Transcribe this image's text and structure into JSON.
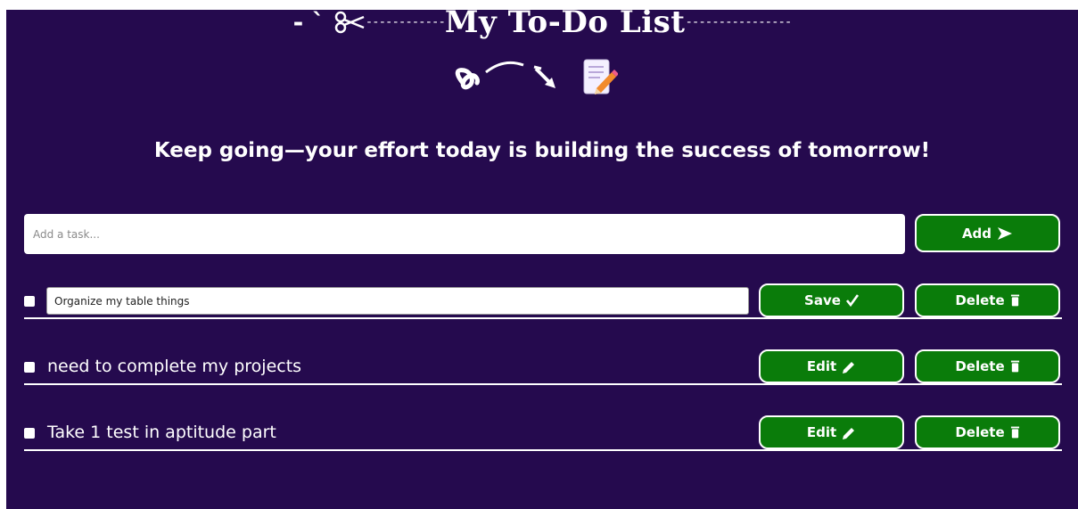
{
  "header": {
    "title": "My To-Do List",
    "motto": "Keep going—your effort today is building the success of tomorrow!"
  },
  "new_task": {
    "placeholder": "Add a task...",
    "add_label": "Add"
  },
  "tasks": [
    {
      "text": "Organize my table things",
      "editing": true,
      "checked": false,
      "primary_label": "Save",
      "delete_label": "Delete"
    },
    {
      "text": "need to complete my projects",
      "editing": false,
      "checked": false,
      "primary_label": "Edit",
      "delete_label": "Delete"
    },
    {
      "text": "Take 1 test in aptitude part",
      "editing": false,
      "checked": false,
      "primary_label": "Edit",
      "delete_label": "Delete"
    }
  ],
  "icons": {
    "scissors": "scissors-icon",
    "add": "send-arrow-icon",
    "save": "checkmark-icon",
    "edit": "pencil-icon",
    "delete": "trash-icon",
    "memo": "memo-icon"
  },
  "colors": {
    "background": "#250a4e",
    "button": "#0a7c0a",
    "text": "#ffffff"
  }
}
